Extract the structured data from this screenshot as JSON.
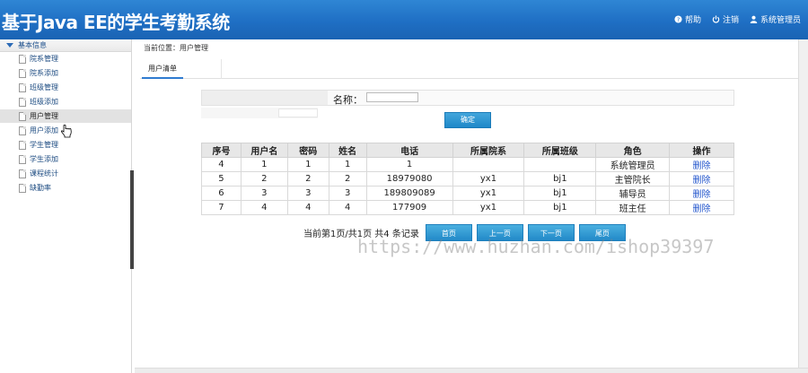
{
  "header": {
    "title": "基于Java EE的学生考勤系统",
    "links": [
      {
        "label": "帮助",
        "icon": "help-icon"
      },
      {
        "label": "注销",
        "icon": "power-icon"
      },
      {
        "label": "系统管理员",
        "icon": "user-icon"
      }
    ]
  },
  "sidebar": {
    "group_label": "基本信息",
    "items": [
      {
        "label": "院系管理"
      },
      {
        "label": "院系添加"
      },
      {
        "label": "班级管理"
      },
      {
        "label": "班级添加"
      },
      {
        "label": "用户管理"
      },
      {
        "label": "用户添加"
      },
      {
        "label": "学生管理"
      },
      {
        "label": "学生添加"
      },
      {
        "label": "课程统计"
      },
      {
        "label": "缺勤率"
      }
    ]
  },
  "breadcrumb": "当前位置：用户管理",
  "tab": "用户清单",
  "search": {
    "label": "名称：",
    "value": "",
    "button": "确定"
  },
  "table": {
    "headers": [
      "序号",
      "用户名",
      "密码",
      "姓名",
      "电话",
      "所属院系",
      "所属班级",
      "角色",
      "操作"
    ],
    "rows": [
      [
        "4",
        "1",
        "1",
        "1",
        "1",
        "",
        "",
        "系统管理员",
        "删除"
      ],
      [
        "5",
        "2",
        "2",
        "2",
        "18979080",
        "yx1",
        "bj1",
        "主管院长",
        "删除"
      ],
      [
        "6",
        "3",
        "3",
        "3",
        "189809089",
        "yx1",
        "bj1",
        "辅导员",
        "删除"
      ],
      [
        "7",
        "4",
        "4",
        "4",
        "177909",
        "yx1",
        "bj1",
        "班主任",
        "删除"
      ]
    ]
  },
  "pager": {
    "text": "当前第1页/共1页  共4 条记录",
    "buttons": [
      "首页",
      "上一页",
      "下一页",
      "尾页"
    ]
  },
  "watermark": "https://www.huzhan.com/ishop39397",
  "colors": {
    "header": "#1f6fc4",
    "accent": "#2289c8",
    "link": "#2255cc"
  }
}
